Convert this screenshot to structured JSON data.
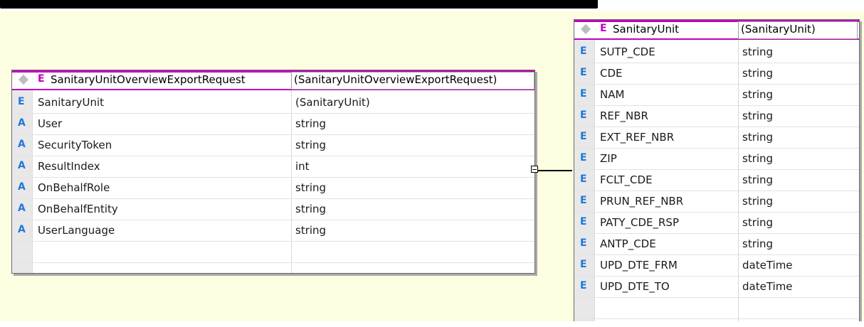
{
  "colors": {
    "canvas": "#fdfde2",
    "header_accent": "#c000c0",
    "element_marker": "#1e78dc",
    "attribute_marker": "#1e78dc"
  },
  "markers": {
    "element": "E",
    "attribute": "A"
  },
  "request_entity": {
    "name": "SanitaryUnitOverviewExportRequest",
    "type": "(SanitaryUnitOverviewExportRequest)",
    "kind": "E",
    "rows": [
      {
        "kind": "E",
        "name": "SanitaryUnit",
        "type": "(SanitaryUnit)"
      },
      {
        "kind": "A",
        "name": "User",
        "type": "string"
      },
      {
        "kind": "A",
        "name": "SecurityToken",
        "type": "string"
      },
      {
        "kind": "A",
        "name": "ResultIndex",
        "type": "int"
      },
      {
        "kind": "A",
        "name": "OnBehalfRole",
        "type": "string"
      },
      {
        "kind": "A",
        "name": "OnBehalfEntity",
        "type": "string"
      },
      {
        "kind": "A",
        "name": "UserLanguage",
        "type": "string"
      }
    ]
  },
  "unit_entity": {
    "name": "SanitaryUnit",
    "type": "(SanitaryUnit)",
    "kind": "E",
    "rows": [
      {
        "kind": "E",
        "name": "SUTP_CDE",
        "type": "string"
      },
      {
        "kind": "E",
        "name": "CDE",
        "type": "string"
      },
      {
        "kind": "E",
        "name": "NAM",
        "type": "string"
      },
      {
        "kind": "E",
        "name": "REF_NBR",
        "type": "string"
      },
      {
        "kind": "E",
        "name": "EXT_REF_NBR",
        "type": "string"
      },
      {
        "kind": "E",
        "name": "ZIP",
        "type": "string"
      },
      {
        "kind": "E",
        "name": "FCLT_CDE",
        "type": "string"
      },
      {
        "kind": "E",
        "name": "PRUN_REF_NBR",
        "type": "string"
      },
      {
        "kind": "E",
        "name": "PATY_CDE_RSP",
        "type": "string"
      },
      {
        "kind": "E",
        "name": "ANTP_CDE",
        "type": "string"
      },
      {
        "kind": "E",
        "name": "UPD_DTE_FRM",
        "type": "dateTime"
      },
      {
        "kind": "E",
        "name": "UPD_DTE_TO",
        "type": "dateTime"
      }
    ]
  }
}
